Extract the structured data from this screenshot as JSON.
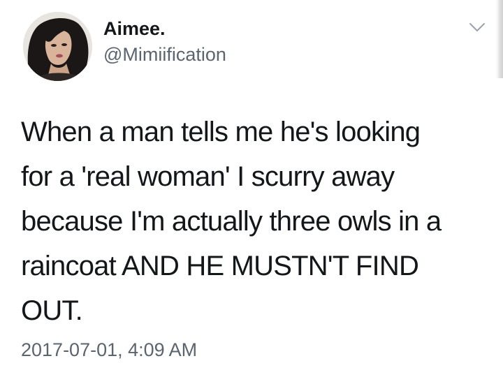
{
  "author": {
    "display_name": "Aimee.",
    "handle": "@Mimiification"
  },
  "tweet": {
    "lines": [
      "When a man tells me he's looking",
      "for a 'real woman' I scurry away",
      "because I'm actually three owls in a",
      "raincoat AND HE MUSTN'T FIND",
      "OUT."
    ],
    "timestamp": "2017-07-01, 4:09 AM"
  },
  "icons": {
    "avatar": "avatar-photo",
    "menu": "chevron-down-icon"
  },
  "colors": {
    "text": "#14171a",
    "secondary_text": "#5b6570",
    "background": "#ffffff"
  }
}
